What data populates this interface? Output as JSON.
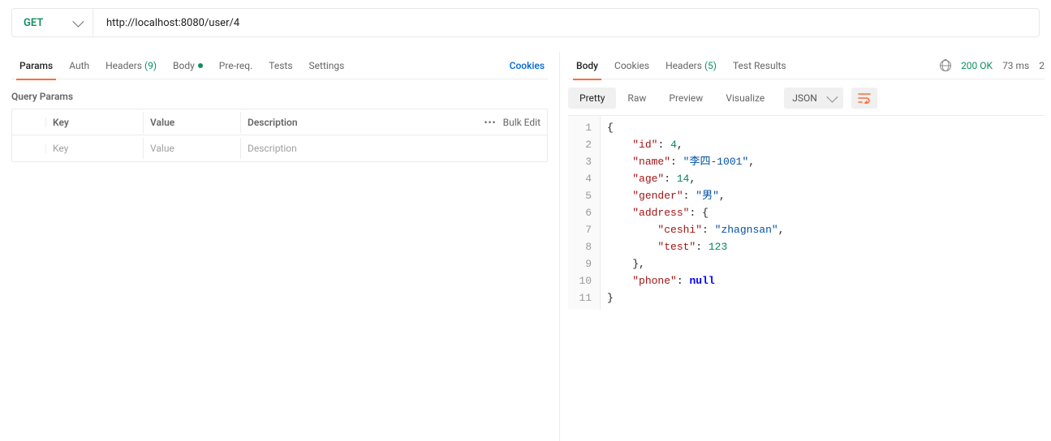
{
  "request": {
    "method": "GET",
    "url": "http://localhost:8080/user/4"
  },
  "leftTabs": {
    "params": "Params",
    "auth": "Auth",
    "headersLabel": "Headers",
    "headersCount": "(9)",
    "body": "Body",
    "prereq": "Pre-req.",
    "tests": "Tests",
    "settings": "Settings",
    "cookies": "Cookies"
  },
  "queryParams": {
    "title": "Query Params",
    "cols": {
      "key": "Key",
      "value": "Value",
      "desc": "Description"
    },
    "placeholders": {
      "key": "Key",
      "value": "Value",
      "desc": "Description"
    },
    "bulkEdit": "Bulk Edit"
  },
  "respTabs": {
    "body": "Body",
    "cookies": "Cookies",
    "headersLabel": "Headers",
    "headersCount": "(5)",
    "testResults": "Test Results"
  },
  "status": {
    "code": "200 OK",
    "time": "73 ms",
    "sizePrefix": "2"
  },
  "viewModes": {
    "pretty": "Pretty",
    "raw": "Raw",
    "preview": "Preview",
    "visualize": "Visualize",
    "format": "JSON"
  },
  "responseBody": {
    "id": 4,
    "name": "李四-1001",
    "age": 14,
    "gender": "男",
    "address": {
      "ceshi": "zhagnsan",
      "test": 123
    },
    "phone": null
  }
}
